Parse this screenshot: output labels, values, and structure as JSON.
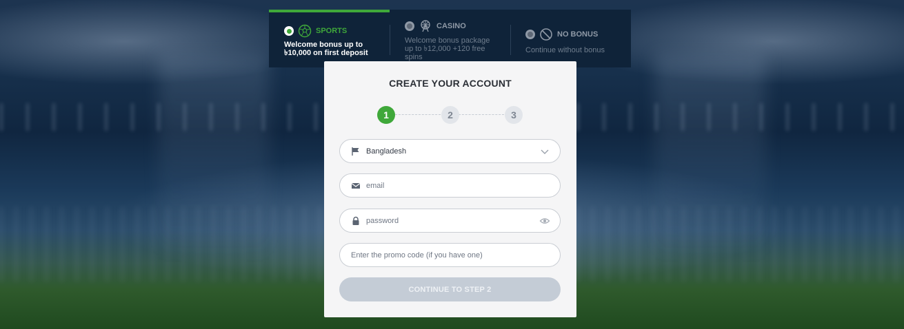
{
  "bonus_options": [
    {
      "title": "SPORTS",
      "description": "Welcome bonus up to ৳10,000 on first deposit",
      "icon": "soccer-ball-icon",
      "selected": true
    },
    {
      "title": "CASINO",
      "description": "Welcome bonus package up to ৳12,000 +120 free spins",
      "icon": "ferris-wheel-icon",
      "selected": false
    },
    {
      "title": "NO BONUS",
      "description": "Continue without bonus",
      "icon": "no-sign-icon",
      "selected": false
    }
  ],
  "form": {
    "title": "CREATE YOUR ACCOUNT",
    "steps": [
      "1",
      "2",
      "3"
    ],
    "active_step": 1,
    "country": {
      "value": "Bangladesh",
      "icon": "flag-icon"
    },
    "email": {
      "placeholder": "email",
      "icon": "envelope-icon"
    },
    "password": {
      "placeholder": "password",
      "icon": "lock-icon"
    },
    "promo": {
      "placeholder": "Enter the promo code (if you have one)"
    },
    "continue_label": "CONTINUE TO STEP 2"
  },
  "colors": {
    "accent": "#3fa83a",
    "bar_bg": "#0f2339",
    "button_disabled": "#c4ccd6"
  }
}
